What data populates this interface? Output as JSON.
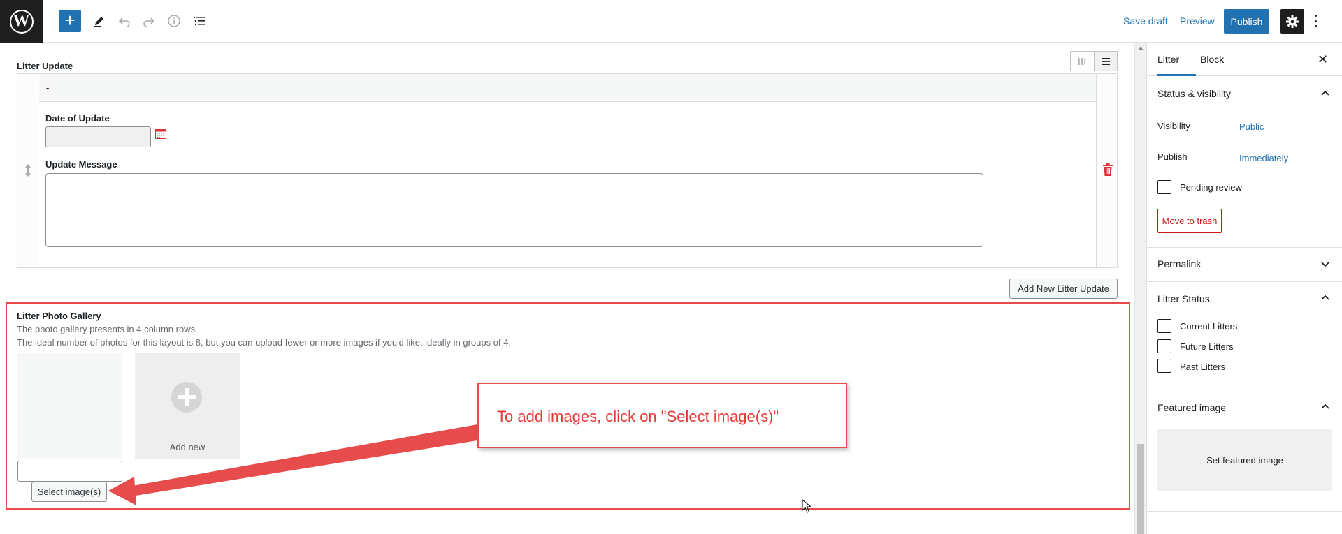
{
  "topbar": {
    "logo_letter": "W",
    "add_symbol": "+",
    "save_draft": "Save draft",
    "preview": "Preview",
    "publish": "Publish",
    "icons": [
      "wordpress-logo",
      "add-block-icon",
      "pencil-tool-icon",
      "undo-icon",
      "redo-icon",
      "info-icon",
      "list-view-icon",
      "gear-icon",
      "more-vertical-icon"
    ]
  },
  "litter_update": {
    "title": "Litter Update",
    "row_header": "-",
    "date_label": "Date of Update",
    "date_value": "",
    "message_label": "Update Message",
    "message_value": "",
    "add_button": "Add New Litter Update"
  },
  "gallery": {
    "title": "Litter Photo Gallery",
    "desc_1": "The photo gallery presents in 4 column rows.",
    "desc_2": "The ideal number of photos for this layout is 8, but you can upload fewer or more images if you'd like, ideally in groups of 4.",
    "add_new": "Add new",
    "select_button": "Select image(s)",
    "input_value": ""
  },
  "annotation": {
    "text": "To add images, click on \"Select image(s)\"",
    "color": "#e53935"
  },
  "sidebar": {
    "tab_active": "Litter",
    "tab_other": "Block",
    "close_symbol": "✕",
    "status_title": "Status & visibility",
    "visibility_label": "Visibility",
    "visibility_value": "Public",
    "publish_label": "Publish",
    "publish_value": "Immediately",
    "pending_review": "Pending review",
    "move_to_trash": "Move to trash",
    "permalink_title": "Permalink",
    "litter_status_title": "Litter Status",
    "status_options": [
      "Current Litters",
      "Future Litters",
      "Past Litters"
    ],
    "featured_title": "Featured image",
    "set_featured": "Set featured image"
  },
  "colors": {
    "accent": "#2271b1",
    "annotation_red": "#e74c4c",
    "danger": "#cc1818"
  }
}
